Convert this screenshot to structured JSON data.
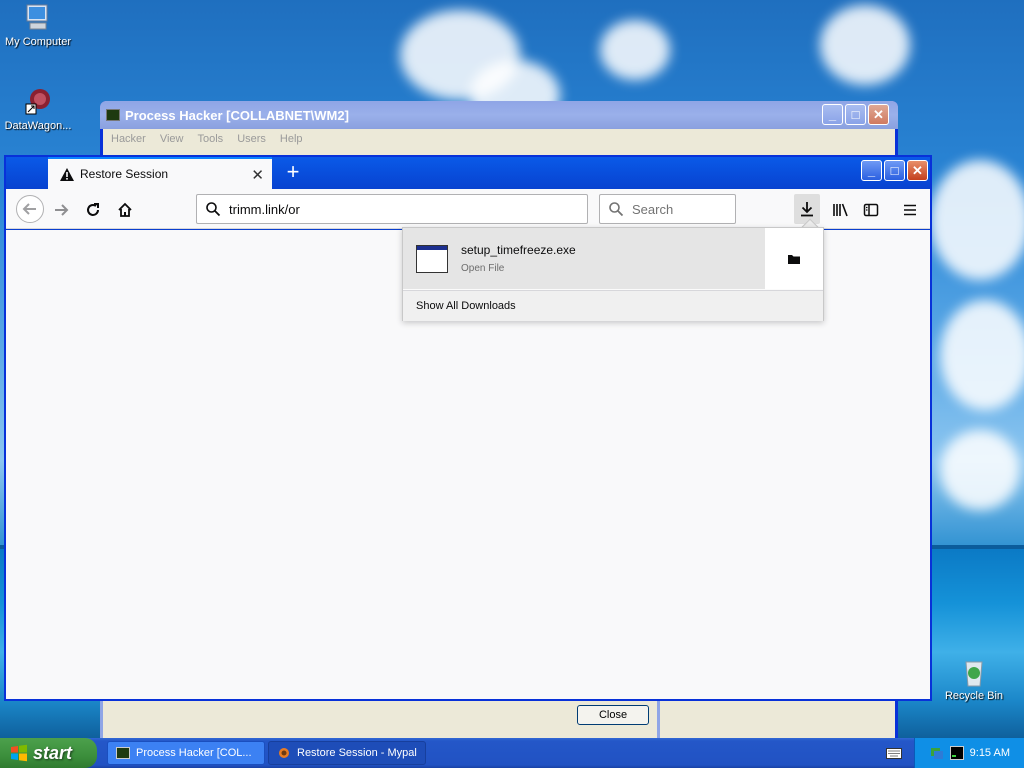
{
  "desktop": {
    "icons": [
      {
        "label": "My Computer"
      },
      {
        "label": "DataWagon..."
      },
      {
        "label": "Recycle Bin"
      }
    ]
  },
  "process_hacker": {
    "title": "Process Hacker [COLLABNET\\WM2]",
    "menu": [
      "Hacker",
      "View",
      "Tools",
      "Users",
      "Help"
    ],
    "close_label": "Close"
  },
  "browser": {
    "tab_title": "Restore Session",
    "url": "trimm.link/or",
    "search_placeholder": "Search",
    "downloads": {
      "file_name": "setup_timefreeze.exe",
      "status": "Open File",
      "show_all": "Show All Downloads"
    }
  },
  "taskbar": {
    "start_label": "start",
    "tasks": [
      {
        "label": "Process Hacker [COL..."
      },
      {
        "label": "Restore Session - Mypal"
      }
    ],
    "clock": "9:15 AM"
  },
  "colors": {
    "xp_blue": "#0831d9",
    "start_green": "#3c8f3c",
    "firefox_blue": "#0a84ff"
  }
}
